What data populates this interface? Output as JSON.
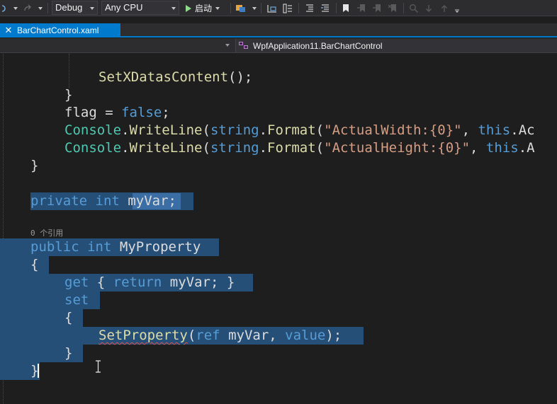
{
  "toolbar": {
    "config": "Debug",
    "platform": "Any CPU",
    "start_label": "启动"
  },
  "tab": {
    "title": "BarChartControl.xaml",
    "close": "✕"
  },
  "navbar": {
    "class_path": "WpfApplication11.BarChartControl"
  },
  "code": {
    "line1_call": "SetXDatasContent",
    "line1_rest": "();",
    "brace_close": "}",
    "flag_stmt_pre": "flag = ",
    "false_kw": "false",
    "semicolon": ";",
    "console": "Console",
    "writeline": "WriteLine",
    "string_kw": "string",
    "format": "Format",
    "width_str": "\"ActualWidth:{0}\"",
    "height_str": "\"ActualHeight:{0}\"",
    "this_kw": "this",
    "ac_tail": ".Ac",
    "a_tail": ".A",
    "private_kw": "private",
    "int_kw": "int",
    "myvar_decl": "myVar;",
    "codelens": "0 个引用",
    "public_kw": "public",
    "property_name": "MyProperty",
    "brace_open": "{",
    "get_kw": "get",
    "return_kw": "return",
    "get_body_rest": "myVar; }",
    "set_kw": "set",
    "set_property_call": "SetProperty",
    "ref_kw": "ref",
    "value_kw": "value",
    "myvar_arg": "myVar, ",
    "call_close": ");"
  },
  "colors": {
    "selection": "#264f78",
    "keyword": "#569cd6",
    "type": "#4ec9b0",
    "string": "#d69d85",
    "method": "#dcdcaa",
    "accent": "#007acc"
  }
}
